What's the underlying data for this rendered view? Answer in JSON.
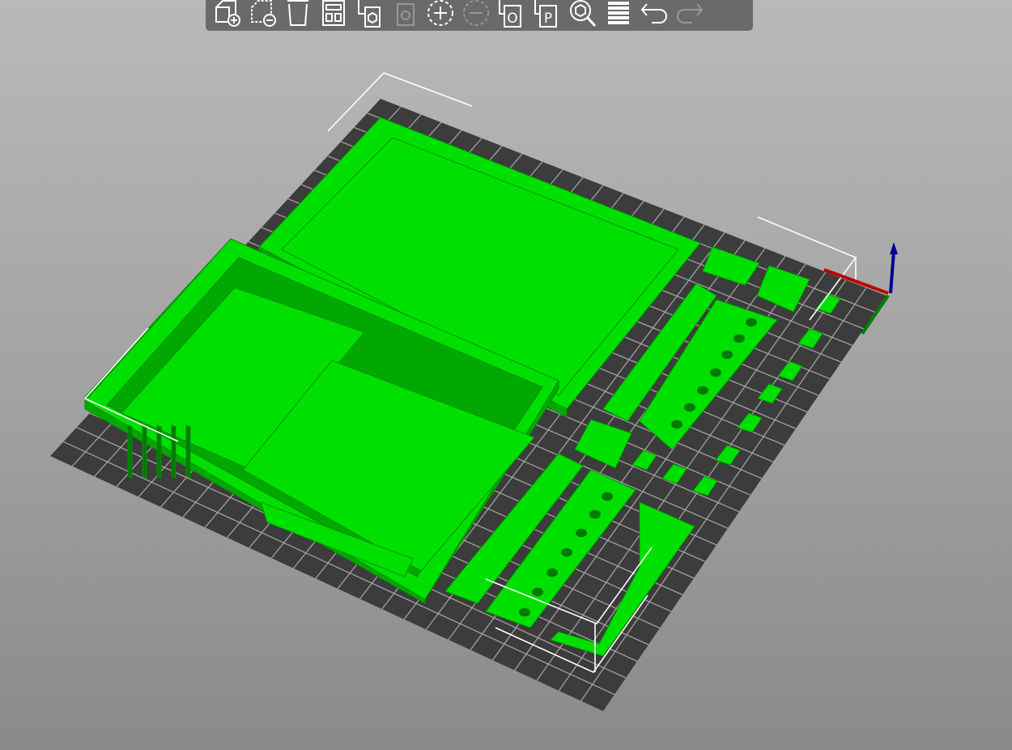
{
  "toolbar": {
    "buttons": [
      {
        "icon": "add-object-icon",
        "enabled": true
      },
      {
        "icon": "delete-object-icon",
        "enabled": true
      },
      {
        "icon": "delete-all-icon",
        "enabled": true
      },
      {
        "icon": "arrange-icon",
        "enabled": true
      },
      {
        "icon": "copy-icon",
        "enabled": true
      },
      {
        "icon": "paste-icon",
        "enabled": false
      },
      {
        "icon": "add-instance-icon",
        "enabled": true
      },
      {
        "icon": "remove-instance-icon",
        "enabled": false
      },
      {
        "icon": "split-to-objects-icon",
        "enabled": true
      },
      {
        "icon": "split-to-parts-icon",
        "enabled": true
      },
      {
        "icon": "search-icon",
        "enabled": true
      },
      {
        "icon": "layers-editing-icon",
        "enabled": true
      },
      {
        "icon": "undo-icon",
        "enabled": true
      },
      {
        "icon": "redo-icon",
        "enabled": false
      }
    ],
    "split_objects_letter": "O",
    "split_parts_letter": "P"
  },
  "colors": {
    "model": "#00e000",
    "model_dark": "#00a800",
    "bed": "#3c3c3c",
    "grid": "#b4b4b4",
    "axis_x": "#c00000",
    "axis_z": "#00008c"
  }
}
